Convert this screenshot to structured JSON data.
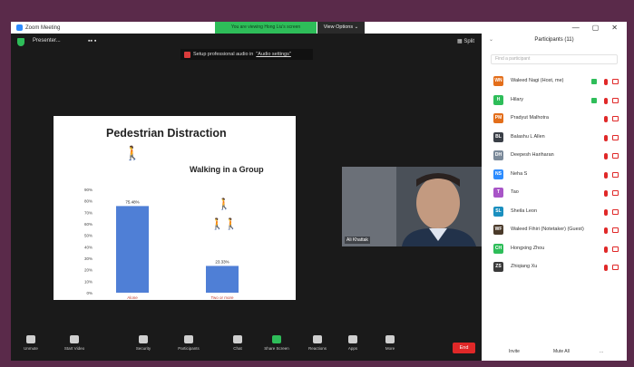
{
  "window": {
    "title": "Zoom Meeting"
  },
  "banner": {
    "text": "You are viewing Hong Liu's screen",
    "view_options": "View Options ⌄"
  },
  "window_controls": [
    "—",
    "▢",
    "✕"
  ],
  "topbar": {
    "presenting_label": "Presenter...",
    "dots": "▪▪ ▪",
    "split_label": "▦ Split"
  },
  "audio_hint": {
    "prefix": "Setup professional audio in",
    "link": "\"Audio settings\""
  },
  "slide": {
    "title": "Pedestrian Distraction",
    "subtitle": "Walking in a Group",
    "walker_single": "🚶",
    "walker_group_top": "🚶",
    "walker_group_bottom": "🚶🚶"
  },
  "chart_data": {
    "type": "bar",
    "categories": [
      "Alone",
      "Two or more"
    ],
    "values": [
      75.48,
      23.33
    ],
    "value_labels": [
      "75.48%",
      "23.33%"
    ],
    "ylim": [
      0,
      90
    ],
    "yticks": [
      "0%",
      "10%",
      "20%",
      "30%",
      "40%",
      "50%",
      "60%",
      "70%",
      "80%",
      "90%"
    ],
    "bar_color": "#4f7fd6",
    "title": "",
    "xlabel": "",
    "ylabel": ""
  },
  "video": {
    "name": "Ali Khattak"
  },
  "toolbar": {
    "items": [
      {
        "label": "Unmute",
        "name": "unmute"
      },
      {
        "label": "Start Video",
        "name": "start-video"
      },
      {
        "label": "Security",
        "name": "security"
      },
      {
        "label": "Participants",
        "name": "participants"
      },
      {
        "label": "Chat",
        "name": "chat"
      },
      {
        "label": "Share Screen",
        "name": "share-screen"
      },
      {
        "label": "Reactions",
        "name": "reactions"
      },
      {
        "label": "Apps",
        "name": "apps"
      },
      {
        "label": "More",
        "name": "more"
      }
    ],
    "end_label": "End"
  },
  "panel": {
    "header": "Participants (11)",
    "search_placeholder": "Find a participant",
    "participants": [
      {
        "initials": "WN",
        "name": "Waleed Nagi (Host, me)",
        "color": "#e36e1a",
        "video_on": true
      },
      {
        "initials": "H",
        "name": "Hilary",
        "color": "#2ebd59",
        "video_on": true
      },
      {
        "initials": "PM",
        "name": "Pradyut Malhotra",
        "color": "#e36e1a",
        "video_on": false
      },
      {
        "initials": "BL",
        "name": "Balashu L Allen",
        "color": "#3a3f47",
        "video_on": false
      },
      {
        "initials": "DH",
        "name": "Deepesh Hariharan",
        "color": "#7b8a9a",
        "video_on": false
      },
      {
        "initials": "NS",
        "name": "Neha S",
        "color": "#2d8cff",
        "video_on": false
      },
      {
        "initials": "T",
        "name": "Tao",
        "color": "#a855c7",
        "video_on": false
      },
      {
        "initials": "SL",
        "name": "Sheila Leon",
        "color": "#1a8fbf",
        "video_on": false
      },
      {
        "initials": "WF",
        "name": "Waleed Fihiri (Notetaker) (Guest)",
        "color": "#4a3a2a",
        "video_on": false
      },
      {
        "initials": "CH",
        "name": "Hongxing Zhou",
        "color": "#2ebd59",
        "video_on": false
      },
      {
        "initials": "ZS",
        "name": "Zhiqiang Xu",
        "color": "#3a3a3a",
        "video_on": false
      }
    ],
    "invite": "Invite",
    "mute_all": "Mute All",
    "more": "..."
  }
}
